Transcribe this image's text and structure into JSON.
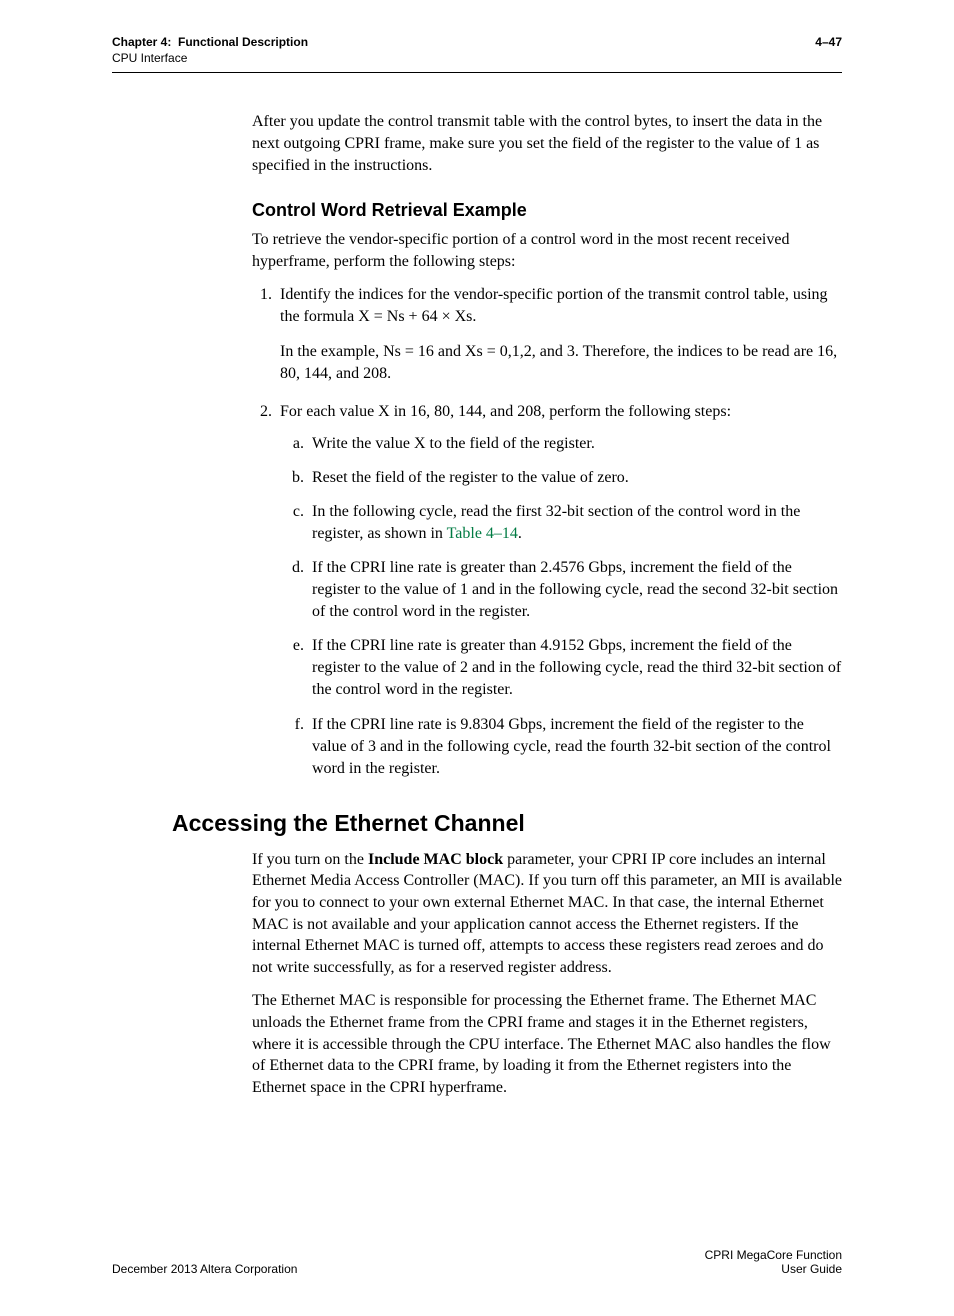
{
  "header": {
    "chapter_label": "Chapter 4:",
    "chapter_title": "Functional Description",
    "section": "CPU Interface",
    "page_num": "4–47"
  },
  "intro_para": "After you update the control transmit table with the control bytes, to insert the data in the next outgoing CPRI frame, make sure you set the                            field of the                              register to the value of 1 as specified in the instructions.",
  "h3": "Control Word Retrieval Example",
  "retrieval_intro": "To retrieve the vendor-specific portion of a control word in the most recent received hyperframe, perform the following steps:",
  "steps": {
    "s1_a": "Identify the indices for the vendor-specific portion of the transmit control table, using the formula X = Ns + 64 × Xs.",
    "s1_b": "In the example, Ns = 16 and Xs = 0,1,2, and 3. Therefore, the indices to be read are 16, 80, 144, and 208.",
    "s2_intro": "For each value X in 16, 80, 144, and 208, perform the following steps:",
    "s2a": "Write the value X to the                                               field of the                                               register.",
    "s2b": "Reset the                                               field of the                                               register to the value of zero.",
    "s2c_a": "In the following                               cycle, read the first 32-bit section of the control word in the                               register, as shown in ",
    "s2c_link": "Table 4–14",
    "s2c_b": ".",
    "s2d": "If the CPRI line rate is greater than 2.4576 Gbps, increment the                                                     field of the                                                     register to the value of 1 and in the following                               cycle, read the second 32-bit section of the control word in the                               register.",
    "s2e": "If the CPRI line rate is greater than 4.9152 Gbps, increment the                                                     field of the                                                     register to the value of 2 and in the following                               cycle, read the third 32-bit section of the control word in the                               register.",
    "s2f": "If the CPRI line rate is 9.8304 Gbps, increment the                                                     field of the                               register to the value of 3 and in the following                               cycle, read the fourth 32-bit section of the control word in the                               register."
  },
  "h2": "Accessing the Ethernet Channel",
  "eth_p1_a": "If you turn on the ",
  "eth_p1_bold": "Include MAC block",
  "eth_p1_b": " parameter, your CPRI IP core includes an internal Ethernet Media Access Controller (MAC). If you turn off this parameter, an MII is available for you to connect to your own external Ethernet MAC. In that case, the internal Ethernet MAC is not available and your application cannot access the Ethernet registers. If the internal Ethernet MAC is turned off, attempts to access these registers read zeroes and do not write successfully, as for a reserved register address.",
  "eth_p2": "The Ethernet MAC is responsible for processing the Ethernet frame. The Ethernet MAC unloads the Ethernet frame from the CPRI frame and stages it in the Ethernet registers, where it is accessible through the CPU interface. The Ethernet MAC also handles the flow of Ethernet data to the CPRI frame, by loading it from the Ethernet registers into the Ethernet space in the CPRI hyperframe.",
  "footer": {
    "left": "December 2013   Altera Corporation",
    "right_1": "CPRI MegaCore Function",
    "right_2": "User Guide"
  }
}
